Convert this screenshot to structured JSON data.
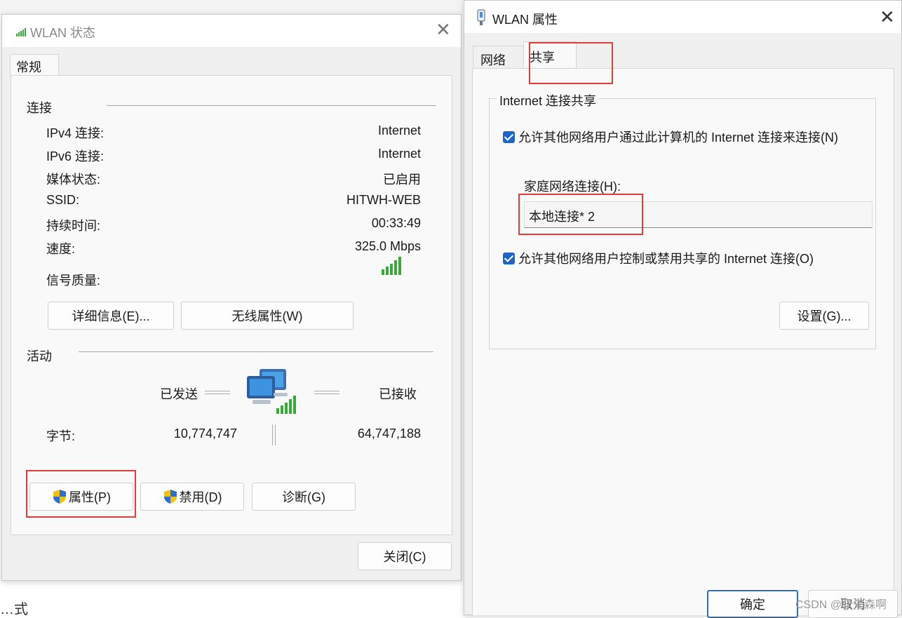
{
  "background_text": "…式",
  "status_dialog": {
    "title": "WLAN 状态",
    "tab": "常规",
    "connection": {
      "heading": "连接",
      "rows": [
        {
          "label": "IPv4 连接:",
          "value": "Internet"
        },
        {
          "label": "IPv6 连接:",
          "value": "Internet"
        },
        {
          "label": "媒体状态:",
          "value": "已启用"
        },
        {
          "label": "SSID:",
          "value": "HITWH-WEB"
        },
        {
          "label": "持续时间:",
          "value": "00:33:49"
        },
        {
          "label": "速度:",
          "value": "325.0 Mbps"
        }
      ],
      "signal_label": "信号质量:",
      "signal_bars": 5
    },
    "buttons": {
      "details": "详细信息(E)...",
      "wireless": "无线属性(W)"
    },
    "activity": {
      "heading": "活动",
      "sent_label": "已发送",
      "received_label": "已接收",
      "bytes_label": "字节:",
      "bytes_sent": "10,774,747",
      "bytes_received": "64,747,188"
    },
    "bottom_buttons": {
      "properties": "属性(P)",
      "disable": "禁用(D)",
      "diagnose": "诊断(G)"
    },
    "close": "关闭(C)"
  },
  "props_dialog": {
    "title": "WLAN 属性",
    "tabs": [
      "网络",
      "共享"
    ],
    "active_tab": "共享",
    "group_title": "Internet 连接共享",
    "allow_connect": {
      "checked": true,
      "label": "允许其他网络用户通过此计算机的 Internet 连接来连接(N)"
    },
    "home_label": "家庭网络连接(H):",
    "home_value": "本地连接* 2",
    "allow_control": {
      "checked": true,
      "label": "允许其他网络用户控制或禁用共享的 Internet 连接(O)"
    },
    "settings_button": "设置(G)...",
    "ok_button": "确定",
    "cancel_button": "取消"
  },
  "watermark": "CSDN @张先森啊",
  "colors": {
    "accent": "#1f64c8",
    "highlight": "#e23b3b",
    "signal": "#3aa83a",
    "shield_blue": "#2b6fd6",
    "shield_yellow": "#f4c20d"
  }
}
